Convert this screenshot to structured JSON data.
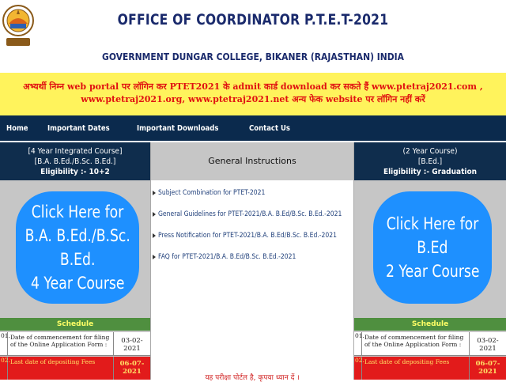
{
  "header": {
    "title": "OFFICE OF COORDINATOR P.T.E.T-2021",
    "subtitle": "GOVERNMENT DUNGAR COLLEGE, BIKANER (RAJASTHAN) INDIA"
  },
  "notice": {
    "text": "अभ्यर्थी निम्न web portal पर लॉगिन कर PTET2021 के admit कार्ड download कर सकते हैं www.ptetraj2021.com , www.ptetraj2021.org, www.ptetraj2021.net अन्य फेक website पर लॉगिन नहीं करें"
  },
  "nav": {
    "items": [
      "Home",
      "Important Dates",
      "Important Downloads",
      "Contact Us"
    ]
  },
  "left_course": {
    "line1": "[4 Year Integrated Course]",
    "line2": "[B.A. B.Ed./B.Sc. B.Ed.]",
    "eligibility": "Eligibility :- 10+2",
    "button_lines": [
      "Click Here for",
      "B.A. B.Ed./B.Sc.",
      "B.Ed.",
      "4 Year Course"
    ]
  },
  "right_course": {
    "line1": "(2 Year Course)",
    "line2": "[B.Ed.]",
    "eligibility": "Eligibility :- Graduation",
    "button_lines": [
      "Click Here for",
      "B.Ed",
      "2 Year Course"
    ]
  },
  "instructions": {
    "title": "General Instructions",
    "links": [
      "Subject Combination for PTET-2021",
      "General Guidelines for PTET-2021/B.A. B.Ed/B.Sc. B.Ed.-2021",
      "Press Notification for PTET-2021/B.A. B.Ed/B.Sc. B.Ed.-2021",
      "FAQ for PTET-2021/B.A. B.Ed/B.Sc. B.Ed.-2021"
    ],
    "footer_text": "यह परीक्षा पोर्टल है, कृपया ध्यान दें ।"
  },
  "schedule": {
    "title": "Schedule",
    "rows": [
      {
        "sn": "01.",
        "desc": "Date of commencement for filing of the Online Application Form :",
        "date": "03-02-2021"
      },
      {
        "sn": "02.",
        "desc": "Last date of depositing Fees",
        "date": "06-07-2021"
      }
    ]
  },
  "colors": {
    "nav_bg": "#0b2a4d",
    "notice_bg": "#fff35c",
    "notice_text": "#e01010",
    "button_blue": "#1e90ff",
    "schedule_green": "#4f8f3f",
    "schedule_red": "#e21b1b"
  },
  "icons": {
    "logo": "college-emblem-icon",
    "bullet": "triangle-bullet-icon"
  }
}
